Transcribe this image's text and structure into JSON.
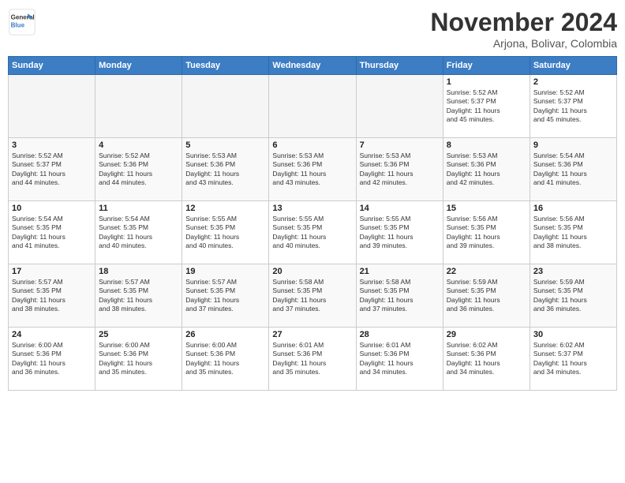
{
  "header": {
    "logo_line1": "General",
    "logo_line2": "Blue",
    "month_title": "November 2024",
    "location": "Arjona, Bolivar, Colombia"
  },
  "weekdays": [
    "Sunday",
    "Monday",
    "Tuesday",
    "Wednesday",
    "Thursday",
    "Friday",
    "Saturday"
  ],
  "weeks": [
    [
      {
        "day": "",
        "info": ""
      },
      {
        "day": "",
        "info": ""
      },
      {
        "day": "",
        "info": ""
      },
      {
        "day": "",
        "info": ""
      },
      {
        "day": "",
        "info": ""
      },
      {
        "day": "1",
        "info": "Sunrise: 5:52 AM\nSunset: 5:37 PM\nDaylight: 11 hours\nand 45 minutes."
      },
      {
        "day": "2",
        "info": "Sunrise: 5:52 AM\nSunset: 5:37 PM\nDaylight: 11 hours\nand 45 minutes."
      }
    ],
    [
      {
        "day": "3",
        "info": "Sunrise: 5:52 AM\nSunset: 5:37 PM\nDaylight: 11 hours\nand 44 minutes."
      },
      {
        "day": "4",
        "info": "Sunrise: 5:52 AM\nSunset: 5:36 PM\nDaylight: 11 hours\nand 44 minutes."
      },
      {
        "day": "5",
        "info": "Sunrise: 5:53 AM\nSunset: 5:36 PM\nDaylight: 11 hours\nand 43 minutes."
      },
      {
        "day": "6",
        "info": "Sunrise: 5:53 AM\nSunset: 5:36 PM\nDaylight: 11 hours\nand 43 minutes."
      },
      {
        "day": "7",
        "info": "Sunrise: 5:53 AM\nSunset: 5:36 PM\nDaylight: 11 hours\nand 42 minutes."
      },
      {
        "day": "8",
        "info": "Sunrise: 5:53 AM\nSunset: 5:36 PM\nDaylight: 11 hours\nand 42 minutes."
      },
      {
        "day": "9",
        "info": "Sunrise: 5:54 AM\nSunset: 5:36 PM\nDaylight: 11 hours\nand 41 minutes."
      }
    ],
    [
      {
        "day": "10",
        "info": "Sunrise: 5:54 AM\nSunset: 5:35 PM\nDaylight: 11 hours\nand 41 minutes."
      },
      {
        "day": "11",
        "info": "Sunrise: 5:54 AM\nSunset: 5:35 PM\nDaylight: 11 hours\nand 40 minutes."
      },
      {
        "day": "12",
        "info": "Sunrise: 5:55 AM\nSunset: 5:35 PM\nDaylight: 11 hours\nand 40 minutes."
      },
      {
        "day": "13",
        "info": "Sunrise: 5:55 AM\nSunset: 5:35 PM\nDaylight: 11 hours\nand 40 minutes."
      },
      {
        "day": "14",
        "info": "Sunrise: 5:55 AM\nSunset: 5:35 PM\nDaylight: 11 hours\nand 39 minutes."
      },
      {
        "day": "15",
        "info": "Sunrise: 5:56 AM\nSunset: 5:35 PM\nDaylight: 11 hours\nand 39 minutes."
      },
      {
        "day": "16",
        "info": "Sunrise: 5:56 AM\nSunset: 5:35 PM\nDaylight: 11 hours\nand 38 minutes."
      }
    ],
    [
      {
        "day": "17",
        "info": "Sunrise: 5:57 AM\nSunset: 5:35 PM\nDaylight: 11 hours\nand 38 minutes."
      },
      {
        "day": "18",
        "info": "Sunrise: 5:57 AM\nSunset: 5:35 PM\nDaylight: 11 hours\nand 38 minutes."
      },
      {
        "day": "19",
        "info": "Sunrise: 5:57 AM\nSunset: 5:35 PM\nDaylight: 11 hours\nand 37 minutes."
      },
      {
        "day": "20",
        "info": "Sunrise: 5:58 AM\nSunset: 5:35 PM\nDaylight: 11 hours\nand 37 minutes."
      },
      {
        "day": "21",
        "info": "Sunrise: 5:58 AM\nSunset: 5:35 PM\nDaylight: 11 hours\nand 37 minutes."
      },
      {
        "day": "22",
        "info": "Sunrise: 5:59 AM\nSunset: 5:35 PM\nDaylight: 11 hours\nand 36 minutes."
      },
      {
        "day": "23",
        "info": "Sunrise: 5:59 AM\nSunset: 5:35 PM\nDaylight: 11 hours\nand 36 minutes."
      }
    ],
    [
      {
        "day": "24",
        "info": "Sunrise: 6:00 AM\nSunset: 5:36 PM\nDaylight: 11 hours\nand 36 minutes."
      },
      {
        "day": "25",
        "info": "Sunrise: 6:00 AM\nSunset: 5:36 PM\nDaylight: 11 hours\nand 35 minutes."
      },
      {
        "day": "26",
        "info": "Sunrise: 6:00 AM\nSunset: 5:36 PM\nDaylight: 11 hours\nand 35 minutes."
      },
      {
        "day": "27",
        "info": "Sunrise: 6:01 AM\nSunset: 5:36 PM\nDaylight: 11 hours\nand 35 minutes."
      },
      {
        "day": "28",
        "info": "Sunrise: 6:01 AM\nSunset: 5:36 PM\nDaylight: 11 hours\nand 34 minutes."
      },
      {
        "day": "29",
        "info": "Sunrise: 6:02 AM\nSunset: 5:36 PM\nDaylight: 11 hours\nand 34 minutes."
      },
      {
        "day": "30",
        "info": "Sunrise: 6:02 AM\nSunset: 5:37 PM\nDaylight: 11 hours\nand 34 minutes."
      }
    ]
  ]
}
